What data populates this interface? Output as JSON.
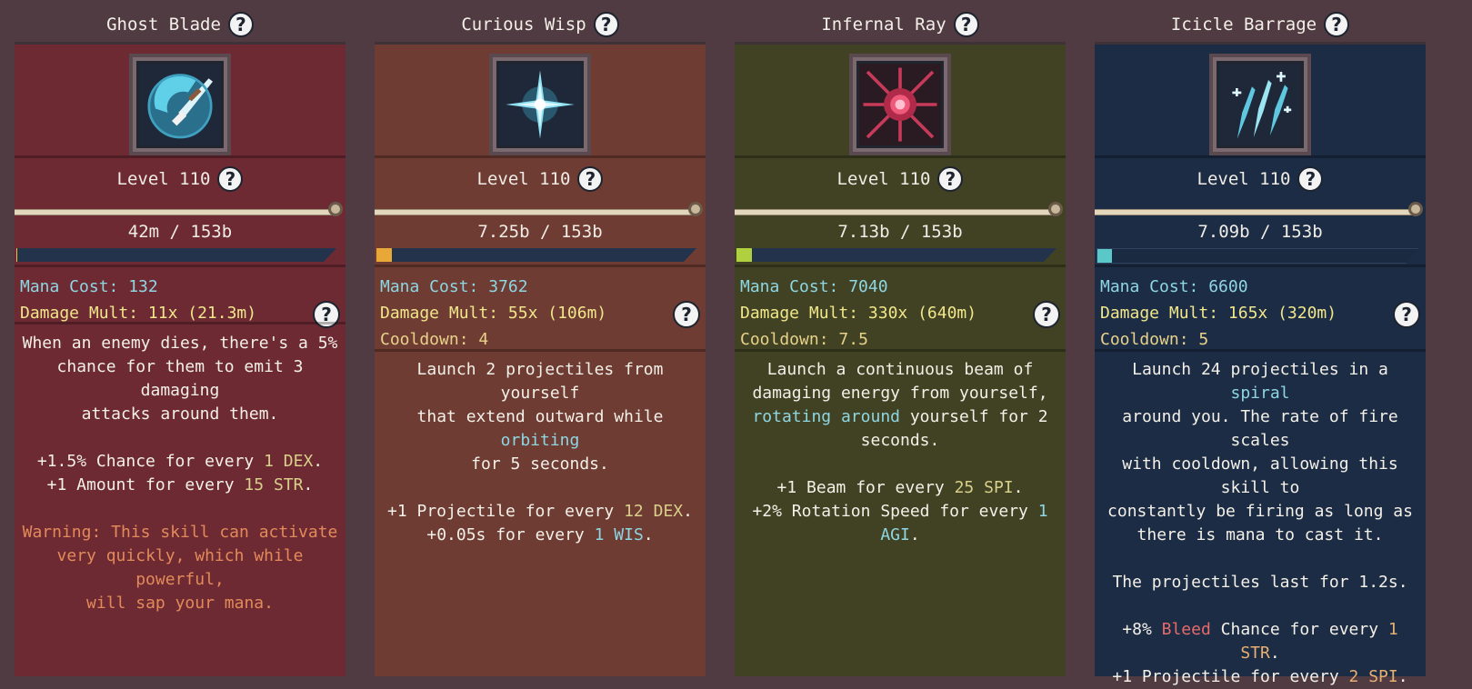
{
  "help_glyph": "?",
  "cards": [
    {
      "title": "Ghost Blade",
      "level": "Level 110",
      "xp": "42m / 153b",
      "xp_progress": 0.0003,
      "mana_label": "Mana Cost:",
      "mana_value": "132",
      "damage_label": "Damage Mult:",
      "damage_value": "11x (21.3m)",
      "cooldown_label": "",
      "cooldown_value": "",
      "desc1": [
        "When an enemy dies, there's a 5%",
        "chance for them to emit 3 damaging",
        "attacks around them."
      ],
      "bonus1": {
        "pre": "+1.5% Chance for every ",
        "amt": "1",
        "stat": "DEX",
        "post": "."
      },
      "bonus2": {
        "pre": "+1 Amount for every ",
        "amt": "15",
        "stat": "STR",
        "post": "."
      },
      "warning": [
        "Warning: This skill can activate",
        "very quickly, which while powerful,",
        "will sap your mana."
      ],
      "colors": {
        "panel": "#6e2a33",
        "fill": "#f0c040"
      },
      "icon": "ghost-blade-icon"
    },
    {
      "title": "Curious Wisp",
      "level": "Level 110",
      "xp": "7.25b / 153b",
      "xp_progress": 0.047,
      "mana_label": "Mana Cost:",
      "mana_value": "3762",
      "damage_label": "Damage Mult:",
      "damage_value": "55x (106m)",
      "cooldown_label": "Cooldown:",
      "cooldown_value": "4",
      "desc_a": "Launch 2 projectiles from yourself",
      "desc_b_pre": "that extend outward while ",
      "desc_b_hl": "orbiting",
      "desc_c": "for 5 seconds.",
      "bonus1": {
        "pre": "+1 Projectile for every ",
        "amt": "12",
        "stat": "DEX",
        "post": "."
      },
      "bonus2": {
        "pre": "+0.05s for every ",
        "amt": "1",
        "stat": "WIS",
        "post": "."
      },
      "colors": {
        "panel": "#6e3c33",
        "fill": "#e8a838"
      },
      "icon": "curious-wisp-icon"
    },
    {
      "title": "Infernal Ray",
      "level": "Level 110",
      "xp": "7.13b / 153b",
      "xp_progress": 0.047,
      "mana_label": "Mana Cost:",
      "mana_value": "7040",
      "damage_label": "Damage Mult:",
      "damage_value": "330x (640m)",
      "cooldown_label": "Cooldown:",
      "cooldown_value": "7.5",
      "desc_a": "Launch a continuous beam of",
      "desc_b": "damaging energy from yourself,",
      "desc_c_hl": "rotating around",
      "desc_c_post": " yourself for 2",
      "desc_d": "seconds.",
      "bonus1": {
        "pre": "+1 Beam for every ",
        "amt": "25",
        "stat": "SPI",
        "post": "."
      },
      "bonus2": {
        "pre": "+2% Rotation Speed for every ",
        "amt": "1",
        "stat": "AGI",
        "post": "."
      },
      "colors": {
        "panel": "#414223",
        "fill": "#b0d040"
      },
      "icon": "infernal-ray-icon"
    },
    {
      "title": "Icicle Barrage",
      "level": "Level 110",
      "xp": "7.09b / 153b",
      "xp_progress": 0.046,
      "mana_label": "Mana Cost:",
      "mana_value": "6600",
      "damage_label": "Damage Mult:",
      "damage_value": "165x (320m)",
      "cooldown_label": "Cooldown:",
      "cooldown_value": "5",
      "desc_a_pre": "Launch 24 projectiles in a ",
      "desc_a_hl": "spiral",
      "desc_b": "around you. The rate of fire scales",
      "desc_c": "with cooldown, allowing this skill to",
      "desc_d": "constantly be firing as long as",
      "desc_e": "there is mana to cast it.",
      "desc_f": "The projectiles last for 1.2s.",
      "bonus1_pre": "+8% ",
      "bonus1_hl": "Bleed",
      "bonus1_mid": " Chance for every ",
      "bonus1_amt": "1",
      "bonus1_stat": "STR",
      "bonus1_post": ".",
      "bonus2": {
        "pre": "+1 Projectile for every ",
        "amt": "2",
        "stat": "SPI",
        "post": "."
      },
      "colors": {
        "panel": "#1d2c45",
        "fill": "#5ac8c8"
      },
      "icon": "icicle-barrage-icon"
    }
  ]
}
